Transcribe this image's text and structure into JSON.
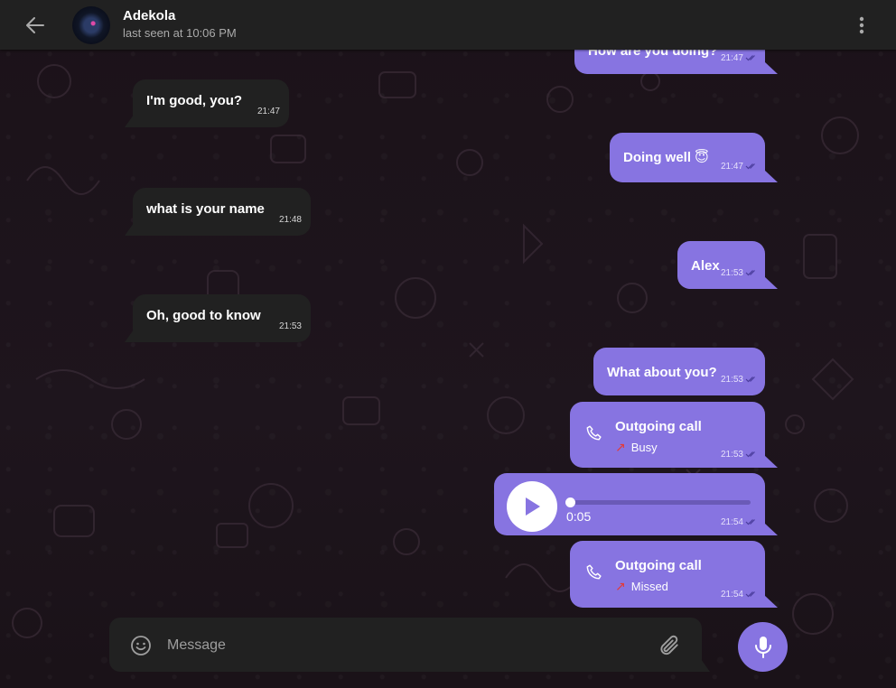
{
  "header": {
    "title": "Adekola",
    "status": "last seen at 10:06 PM"
  },
  "messages": [
    {
      "dir": "out",
      "text": "How are you doing?",
      "time": "21:47"
    },
    {
      "dir": "in",
      "text": "I'm good, you?",
      "time": "21:47"
    },
    {
      "dir": "out",
      "text": "Doing well 😇",
      "time": "21:47"
    },
    {
      "dir": "in",
      "text": "what is your name",
      "time": "21:48"
    },
    {
      "dir": "out",
      "text": "Alex",
      "time": "21:53"
    },
    {
      "dir": "in",
      "text": "Oh, good to know",
      "time": "21:53"
    },
    {
      "dir": "out",
      "text": "What about you?",
      "time": "21:53"
    }
  ],
  "calls": [
    {
      "title": "Outgoing call",
      "status": "Busy",
      "time": "21:53"
    },
    {
      "title": "Outgoing call",
      "status": "Missed",
      "time": "21:54"
    }
  ],
  "voice": {
    "duration": "0:05",
    "time": "21:54",
    "progress": 0
  },
  "composer": {
    "placeholder": "Message"
  },
  "colors": {
    "outgoing_bubble": "#8774e1",
    "incoming_bubble": "#212121",
    "header": "#212121",
    "missed_arrow": "#e53935"
  },
  "icons": [
    "back-arrow-icon",
    "more-vertical-icon",
    "phone-icon",
    "play-icon",
    "emoji-icon",
    "paperclip-icon",
    "microphone-icon",
    "double-check-icon"
  ]
}
